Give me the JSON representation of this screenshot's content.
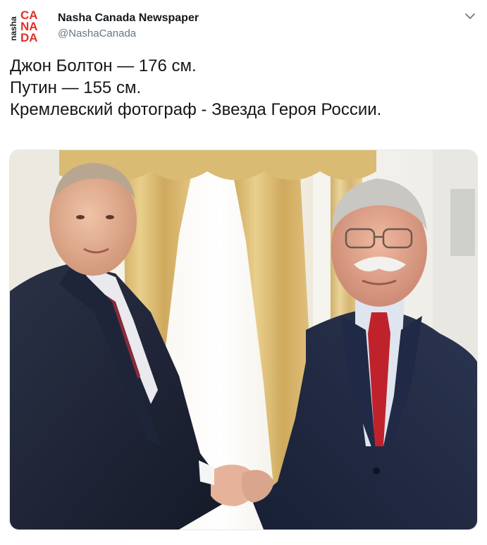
{
  "tweet": {
    "author": {
      "display_name": "Nasha Canada Newspaper",
      "handle": "@NashaCanada",
      "avatar_text": {
        "top": "nasha",
        "ca": "CA",
        "na": "NA",
        "da": "DA"
      },
      "avatar_icon": "nasha-canada-logo"
    },
    "menu_icon": "chevron-down-icon",
    "text_lines": [
      "Джон Болтон — 176 см.",
      "Путин — 155 см.",
      "Кремлевский фотограф - Звезда Героя России."
    ],
    "media": {
      "kind": "photo"
    }
  },
  "colors": {
    "text": "#14171a",
    "secondary_text": "#657786",
    "logo_red": "#e0312a",
    "suit_dark": "#1b2233",
    "tie_red": "#b0222a",
    "curtain_gold": "#d7b46a"
  }
}
